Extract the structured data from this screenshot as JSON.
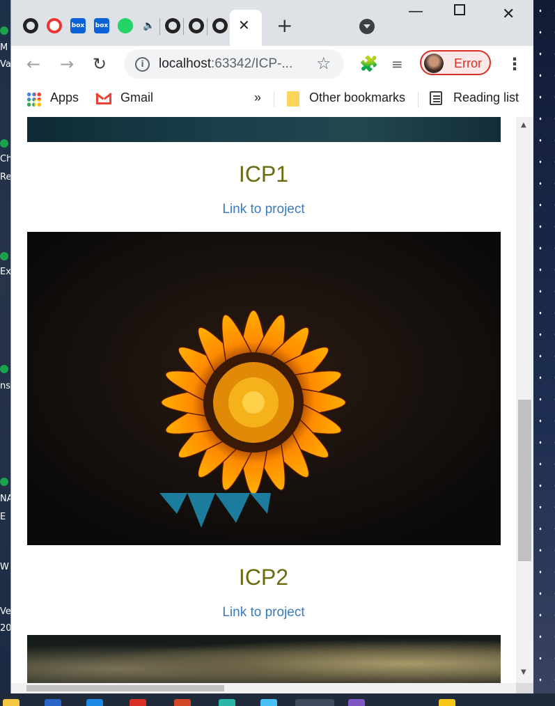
{
  "desktop": {
    "left_labels": [
      "M",
      "Va",
      "Ch",
      "Re",
      "Ex",
      "ns",
      "NA",
      "E",
      "W",
      "Vel",
      "20"
    ]
  },
  "browser": {
    "tabs": [
      {
        "icon": "github-icon"
      },
      {
        "icon": "lifering-icon"
      },
      {
        "icon": "box-icon",
        "label": "box"
      },
      {
        "icon": "box-icon",
        "label": "box"
      },
      {
        "icon": "whatsapp-icon"
      },
      {
        "icon": "speaker-icon"
      },
      {
        "icon": "github-icon"
      },
      {
        "icon": "github-icon"
      },
      {
        "icon": "github-icon"
      }
    ],
    "url_host": "localhost",
    "url_rest": ":63342/ICP-...",
    "profile_status": "Error",
    "bookmarks": {
      "apps": "Apps",
      "gmail": "Gmail",
      "overflow": "»",
      "other": "Other bookmarks",
      "reading_list": "Reading list"
    }
  },
  "page": {
    "projects": [
      {
        "title": "ICP1",
        "link": "Link to project"
      },
      {
        "title": "ICP2",
        "link": "Link to project"
      }
    ]
  },
  "colors": {
    "title": "#6b6b10",
    "link": "#3a7ab8",
    "profile_error": "#d93025"
  }
}
